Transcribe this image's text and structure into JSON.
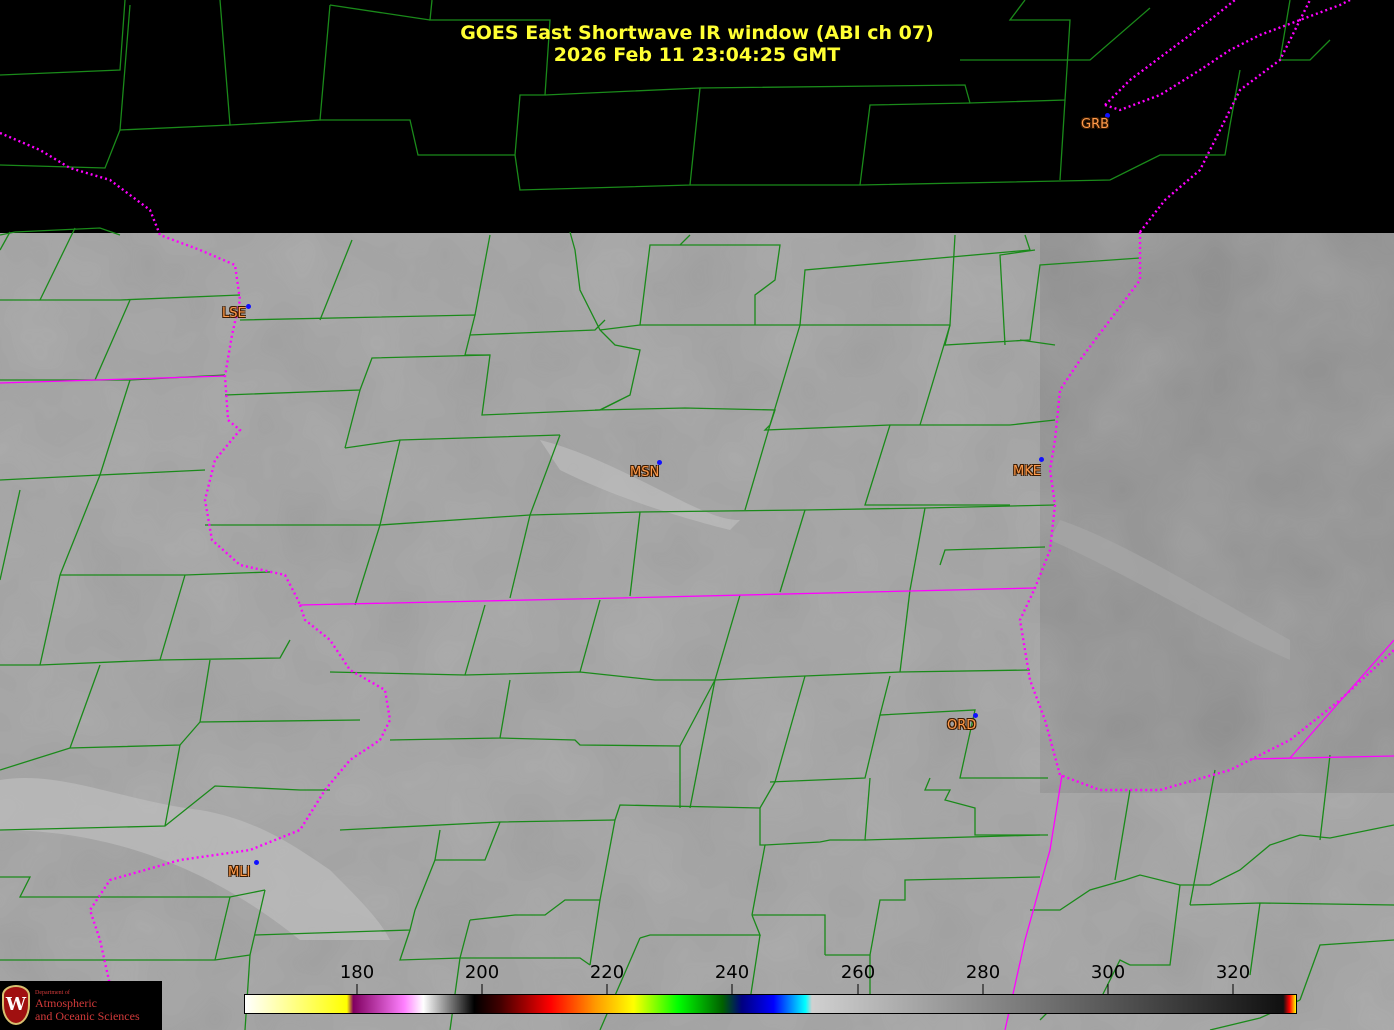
{
  "title": {
    "line1": "GOES East Shortwave IR window (ABI ch 07)",
    "line2": "2026 Feb 11  23:04:25 GMT"
  },
  "stations": [
    {
      "id": "GRB"
    },
    {
      "id": "LSE"
    },
    {
      "id": "MSN"
    },
    {
      "id": "MKE"
    },
    {
      "id": "ORD"
    },
    {
      "id": "MLI"
    }
  ],
  "colorbar": {
    "ticks": [
      "180",
      "200",
      "220",
      "240",
      "260",
      "280",
      "300",
      "320"
    ],
    "range": [
      165,
      330
    ],
    "stops": [
      {
        "t": 165,
        "color": "#ffffff"
      },
      {
        "t": 175,
        "color": "#ffff60"
      },
      {
        "t": 181,
        "color": "#ffff00"
      },
      {
        "t": 182,
        "color": "#800060"
      },
      {
        "t": 190,
        "color": "#ff80ff"
      },
      {
        "t": 193,
        "color": "#ffffff"
      },
      {
        "t": 199,
        "color": "#404040"
      },
      {
        "t": 201,
        "color": "#000000"
      },
      {
        "t": 205,
        "color": "#400000"
      },
      {
        "t": 213,
        "color": "#ff0000"
      },
      {
        "t": 220,
        "color": "#ff9900"
      },
      {
        "t": 226,
        "color": "#ffff00"
      },
      {
        "t": 233,
        "color": "#00ff00"
      },
      {
        "t": 240,
        "color": "#006000"
      },
      {
        "t": 243,
        "color": "#000080"
      },
      {
        "t": 248,
        "color": "#0000ff"
      },
      {
        "t": 253,
        "color": "#00ffff"
      },
      {
        "t": 254,
        "color": "#d0d0d0"
      },
      {
        "t": 328,
        "color": "#101010"
      },
      {
        "t": 329,
        "color": "#ff0000"
      },
      {
        "t": 330,
        "color": "#ffff00"
      }
    ]
  },
  "logo": {
    "dept": "Department of",
    "line1": "Atmospheric",
    "line2": "and Oceanic Sciences"
  },
  "colors": {
    "county_lines": "#1a8a1a",
    "state_lines": "#ff00ff",
    "title": "#ffff33",
    "station_label": "#ff9a4a",
    "station_dot": "#1010ff",
    "imagery_gray": "#a0a0a0"
  }
}
